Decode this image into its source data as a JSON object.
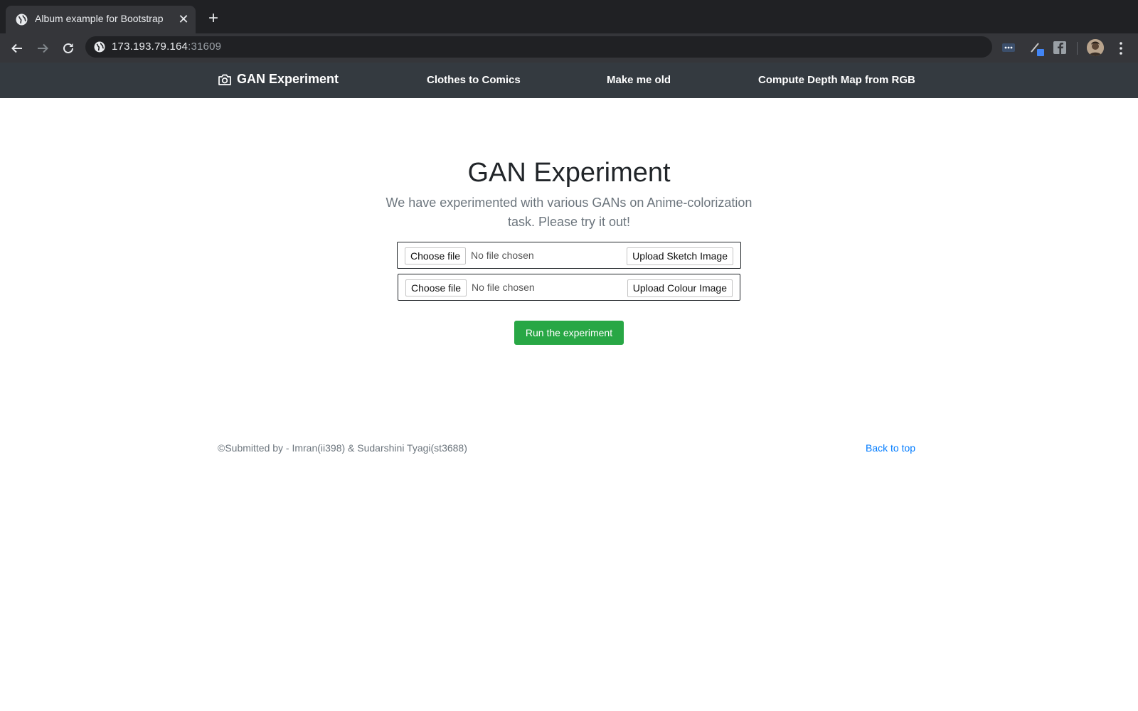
{
  "browser": {
    "tab": {
      "title": "Album example for Bootstrap",
      "favicon": "globe-icon",
      "close_icon": "close-icon"
    },
    "new_tab_icon": "plus-icon",
    "address": {
      "host": "173.193.79.164",
      "port": ":31609",
      "security_icon": "globe-icon"
    },
    "toolbar_icons": [
      "back-arrow-icon",
      "forward-arrow-icon",
      "reload-icon",
      "more-extensions-icon",
      "pencil-extension-icon",
      "facebook-icon",
      "profile-avatar-icon",
      "kebab-menu-icon"
    ]
  },
  "navbar": {
    "brand": "GAN Experiment",
    "brand_icon": "camera-icon",
    "links": [
      "Clothes to Comics",
      "Make me old",
      "Compute Depth Map from RGB"
    ],
    "background": "#343a40"
  },
  "main": {
    "title": "GAN Experiment",
    "lead": "We have experimented with various GANs on Anime-colorization task. Please try it out!",
    "forms": [
      {
        "choose_label": "Choose file",
        "status": "No file chosen",
        "upload_label": "Upload Sketch Image"
      },
      {
        "choose_label": "Choose file",
        "status": "No file chosen",
        "upload_label": "Upload Colour Image"
      }
    ],
    "run_label": "Run the experiment",
    "run_color": "#28a745"
  },
  "footer": {
    "credit": "©Submitted by - Imran(ii398) & Sudarshini Tyagi(st3688)",
    "back_to_top": "Back to top",
    "link_color": "#007bff"
  }
}
